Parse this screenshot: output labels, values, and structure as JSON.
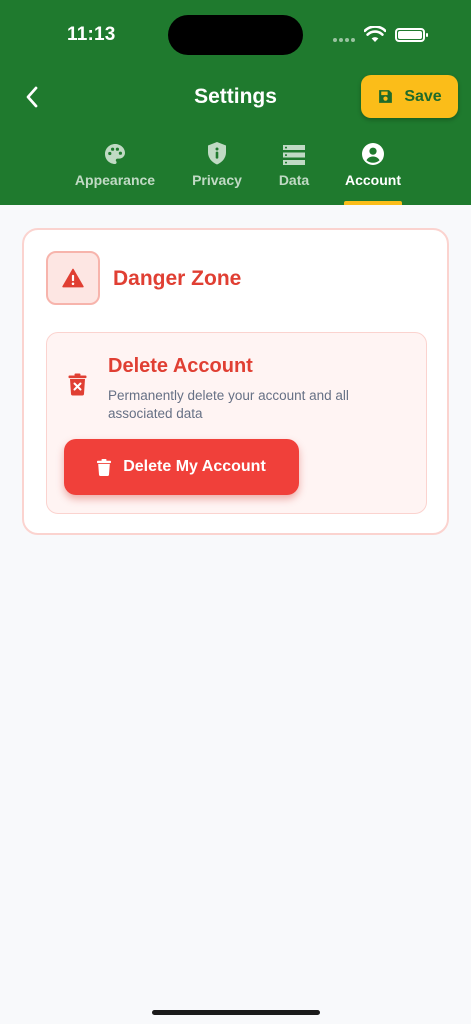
{
  "status_bar": {
    "time": "11:13"
  },
  "header": {
    "title": "Settings",
    "save_label": "Save",
    "colors": {
      "background": "#1f7a2e",
      "accent": "#fbbd19"
    }
  },
  "tabs": [
    {
      "label": "Appearance",
      "icon": "palette-icon",
      "active": false
    },
    {
      "label": "Privacy",
      "icon": "shield-info-icon",
      "active": false
    },
    {
      "label": "Data",
      "icon": "storage-icon",
      "active": false
    },
    {
      "label": "Account",
      "icon": "account-circle-icon",
      "active": true
    }
  ],
  "danger_zone": {
    "title": "Danger Zone",
    "icon": "warning-icon",
    "delete_account": {
      "title": "Delete Account",
      "description": "Permanently delete your account and all associated data",
      "icon": "delete-forever-icon",
      "button_label": "Delete My Account",
      "button_icon": "trash-icon"
    },
    "colors": {
      "danger": "#e03f33",
      "button": "#f0403a"
    }
  }
}
